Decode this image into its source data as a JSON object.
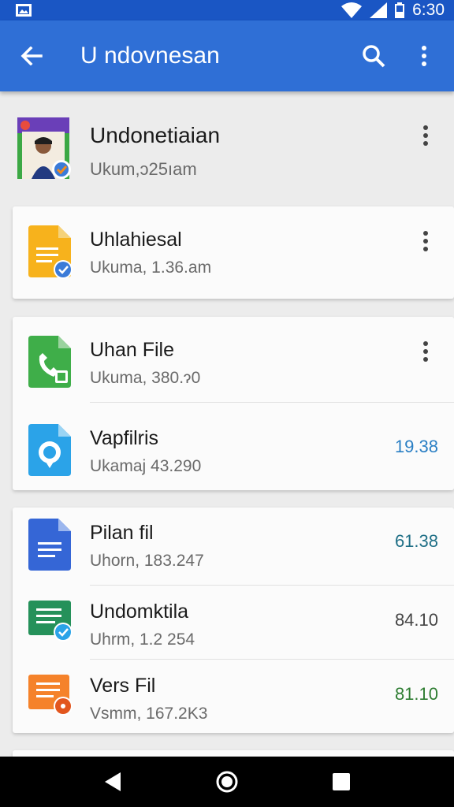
{
  "status_bar": {
    "time": "6:30"
  },
  "app_bar": {
    "title": "U ndovnesan"
  },
  "first_item": {
    "name": "Undonetiaian",
    "meta": "Ukum,ɔ25ıam"
  },
  "card1": {
    "rows": [
      {
        "name": "Uhlahiesal",
        "meta": "Ukuma, 1.36.am"
      }
    ]
  },
  "card2": {
    "rows": [
      {
        "name": "Uhan File",
        "meta": "Ukuma, 380.ɂ0"
      },
      {
        "name": "Vapfilris",
        "meta": "Ukamaj 43.290",
        "size": "19.38",
        "size_color": "#2a7fc4"
      }
    ]
  },
  "card3": {
    "rows": [
      {
        "name": "Pilan fil",
        "meta": "Uhorn, 183.247",
        "size": "61.38",
        "size_color": "#1f6f86"
      },
      {
        "name": "Undomktila",
        "meta": "Uhrm, 1.2 254",
        "size": "84.10",
        "size_color": "#444444"
      },
      {
        "name": "Vers Fil",
        "meta": "Vsmm, 167.2K3",
        "size": "81.10",
        "size_color": "#2e7d32"
      }
    ]
  },
  "icons": {
    "status_notification": "image-icon",
    "wifi": "wifi-icon",
    "signal": "signal-icon",
    "battery": "battery-icon",
    "back": "arrow-back-icon",
    "search": "search-icon",
    "overflow": "more-vert-icon",
    "nav_back": "triangle-back-icon",
    "nav_home": "circle-home-icon",
    "nav_recents": "square-recents-icon"
  },
  "colors": {
    "status_bar": "#1a56c4",
    "app_bar": "#2f6fd6",
    "background": "#ececec",
    "card": "#fbfbfb"
  }
}
